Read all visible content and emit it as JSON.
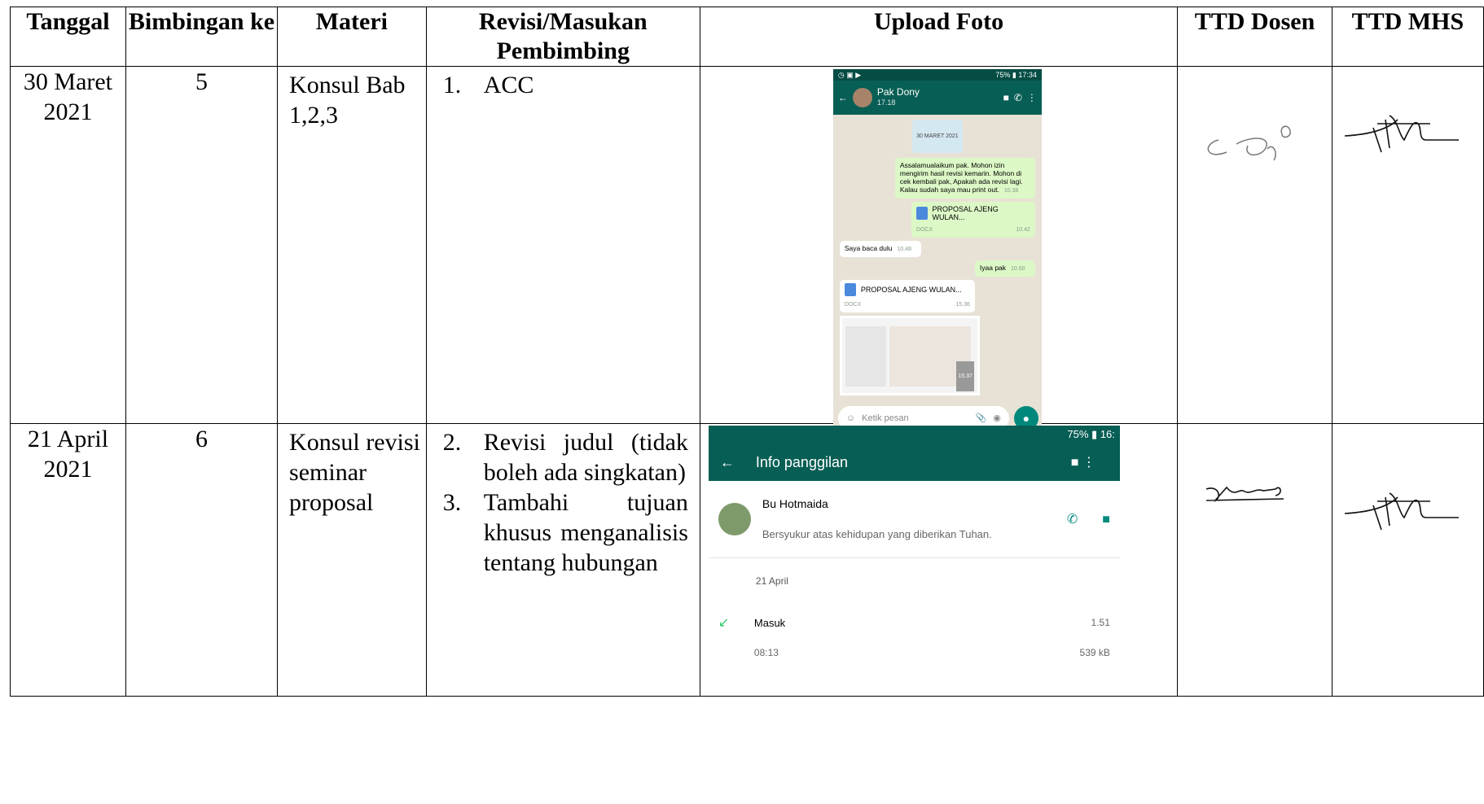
{
  "headers": [
    "Tanggal",
    "Bimbingan ke",
    "Materi",
    "Revisi/Masukan Pembimbing",
    "Upload Foto",
    "TTD Dosen",
    "TTD MHS"
  ],
  "rows": [
    {
      "tanggal": "30 Maret 2021",
      "bimbingan": "5",
      "materi": "Konsul Bab 1,2,3",
      "revisi": [
        {
          "num": "1.",
          "text": "ACC"
        }
      ]
    },
    {
      "tanggal": "21 April 2021",
      "bimbingan": "6",
      "materi": "Konsul revisi seminar proposal",
      "revisi": [
        {
          "num": "2.",
          "text": "Revisi judul (tidak boleh ada singkatan)"
        },
        {
          "num": "3.",
          "text": "Tambahi tujuan khusus menganalisis tentang hubungan"
        }
      ]
    }
  ],
  "chat1": {
    "status_left": "◷ ▣ ▶",
    "status_right": "75% ▮ 17:34",
    "contact": "Pak Dony",
    "contact_sub": "17.18",
    "date_chip": "30 MARET 2021",
    "msg1": "Assalamualaikum pak. Mohon izin mengirim hasil revisi kemarin. Mohon di cek kembali pak, Apakah ada revisi lagi. Kalau sudah saya mau print out.",
    "msg1_time": "10.38",
    "doc1": "PROPOSAL AJENG WULAN...",
    "doc1_type": "DOCX",
    "doc1_time": "10.42",
    "msg2": "Saya baca dulu",
    "msg2_time": "10.48",
    "msg3": "Iyaa pak",
    "msg3_time": "10.50",
    "doc2": "PROPOSAL AJENG WULAN...",
    "doc2_type": "DOCX",
    "doc2_time": "15.36",
    "img_time": "15.37",
    "input_placeholder": "Ketik pesan"
  },
  "chat2": {
    "status": "75% ▮ 16:",
    "title": "Info panggilan",
    "contact": "Bu Hotmaida",
    "contact_status": "Bersyukur atas kehidupan yang diberikan Tuhan.",
    "day": "21 April",
    "call_type": "Masuk",
    "call_time": "08:13",
    "call_duration": "1.51",
    "call_size": "539 kB"
  },
  "icons": {
    "back": "back-arrow-icon",
    "video": "video-call-icon",
    "phone": "phone-icon",
    "menu": "more-vert-icon",
    "mic": "microphone-icon",
    "incoming": "incoming-call-arrow-icon"
  },
  "colors": {
    "wa_green": "#075e54",
    "wa_bubble": "#dcf8c6",
    "wa_accent": "#00897b"
  }
}
